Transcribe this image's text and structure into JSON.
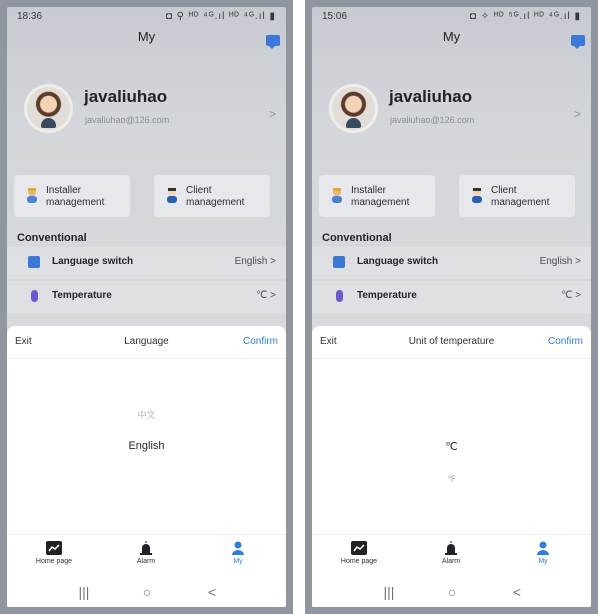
{
  "screens": [
    {
      "status": {
        "time": "18:36",
        "icons": "◘ ⚲ ᴴᴰ ⁴ᴳ.ıl ᴴᴰ ⁴ᴳ.ıl ▮"
      },
      "header": {
        "title": "My"
      },
      "profile": {
        "name": "javaliuhao",
        "email": "javaliuhao@126.com"
      },
      "management": [
        {
          "label": "Installer\nmanagement"
        },
        {
          "label": "Client\nmanagement"
        }
      ],
      "section": "Conventional",
      "settings": [
        {
          "label": "Language switch",
          "value": "English",
          "icon": "language-icon"
        },
        {
          "label": "Temperature",
          "value": "℃",
          "icon": "thermometer-icon"
        }
      ],
      "sheet": {
        "exit": "Exit",
        "title": "Language",
        "confirm": "Confirm",
        "options": [
          "中文",
          "English"
        ],
        "selected": "English"
      },
      "tabs": [
        {
          "label": "Home page"
        },
        {
          "label": "Alarm"
        },
        {
          "label": "My"
        }
      ]
    },
    {
      "status": {
        "time": "15:06",
        "icons": "◘ ✧ ᴴᴰ ⁵ᴳ.ıl ᴴᴰ ⁴ᴳ.ıl ▮"
      },
      "header": {
        "title": "My"
      },
      "profile": {
        "name": "javaliuhao",
        "email": "javaliuhao@126.com"
      },
      "management": [
        {
          "label": "Installer\nmanagement"
        },
        {
          "label": "Client\nmanagement"
        }
      ],
      "section": "Conventional",
      "settings": [
        {
          "label": "Language switch",
          "value": "English",
          "icon": "language-icon"
        },
        {
          "label": "Temperature",
          "value": "℃",
          "icon": "thermometer-icon"
        }
      ],
      "sheet": {
        "exit": "Exit",
        "title": "Unit of temperature",
        "confirm": "Confirm",
        "options": [
          "℃",
          "℉"
        ],
        "selected": "℃"
      },
      "tabs": [
        {
          "label": "Home page"
        },
        {
          "label": "Alarm"
        },
        {
          "label": "My"
        }
      ]
    }
  ],
  "nav": {
    "recent": "|||",
    "home": "○",
    "back": "<"
  },
  "colors": {
    "accent": "#2f7fd6",
    "language_icon": "#3b78d8",
    "thermometer_icon": "#6a5acd"
  }
}
